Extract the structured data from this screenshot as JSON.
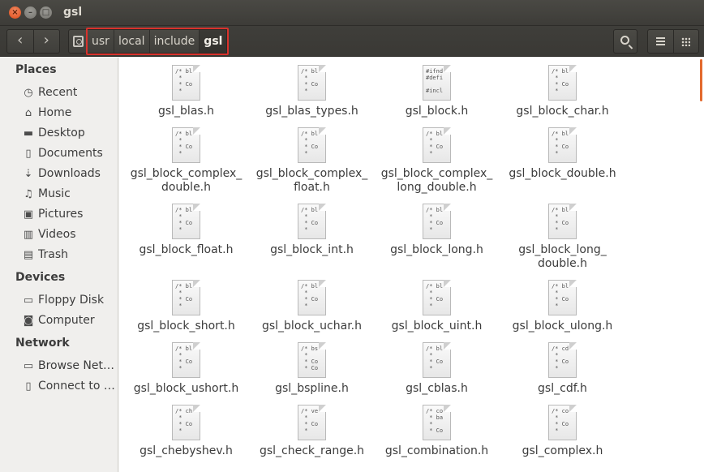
{
  "window": {
    "title": "gsl"
  },
  "toolbar": {
    "back_glyph": "‹",
    "forward_glyph": "›",
    "path": [
      "usr",
      "local",
      "include",
      "gsl"
    ],
    "search_icon": "search-icon",
    "view_icons": [
      "list-view-icon",
      "grid-view-icon"
    ]
  },
  "sidebar": {
    "places_header": "Places",
    "places": [
      {
        "label": "Recent",
        "icon": "clock-icon",
        "glyph": "◷"
      },
      {
        "label": "Home",
        "icon": "home-icon",
        "glyph": "⌂"
      },
      {
        "label": "Desktop",
        "icon": "folder-icon",
        "glyph": "▬"
      },
      {
        "label": "Documents",
        "icon": "document-icon",
        "glyph": "▯"
      },
      {
        "label": "Downloads",
        "icon": "download-icon",
        "glyph": "⇣"
      },
      {
        "label": "Music",
        "icon": "music-icon",
        "glyph": "♫"
      },
      {
        "label": "Pictures",
        "icon": "camera-icon",
        "glyph": "▣"
      },
      {
        "label": "Videos",
        "icon": "film-icon",
        "glyph": "▥"
      },
      {
        "label": "Trash",
        "icon": "trash-icon",
        "glyph": "▤"
      }
    ],
    "devices_header": "Devices",
    "devices": [
      {
        "label": "Floppy Disk",
        "icon": "floppy-icon",
        "glyph": "▭"
      },
      {
        "label": "Computer",
        "icon": "computer-icon",
        "glyph": "◙"
      }
    ],
    "network_header": "Network",
    "network": [
      {
        "label": "Browse Net…",
        "icon": "network-icon",
        "glyph": "▭"
      },
      {
        "label": "Connect to …",
        "icon": "server-icon",
        "glyph": "▯"
      }
    ]
  },
  "files": [
    {
      "name": "gsl_blas.h",
      "preview": "/* bl\n *\n * Co\n *"
    },
    {
      "name": "gsl_blas_types.h",
      "preview": "/* bl\n *\n * Co\n *"
    },
    {
      "name": "gsl_block.h",
      "preview": "#ifnd\n#defi\n\n#incl"
    },
    {
      "name": "gsl_block_char.h",
      "preview": "/* bl\n *\n * Co\n *"
    },
    {
      "name": "gsl_block_complex_\ndouble.h",
      "preview": "/* bl\n *\n * Co\n *"
    },
    {
      "name": "gsl_block_complex_\nfloat.h",
      "preview": "/* bl\n *\n * Co\n *"
    },
    {
      "name": "gsl_block_complex_\nlong_double.h",
      "preview": "/* bl\n *\n * Co\n *"
    },
    {
      "name": "gsl_block_double.h",
      "preview": "/* bl\n *\n * Co\n *"
    },
    {
      "name": "gsl_block_float.h",
      "preview": "/* bl\n *\n * Co\n *"
    },
    {
      "name": "gsl_block_int.h",
      "preview": "/* bl\n *\n * Co\n *"
    },
    {
      "name": "gsl_block_long.h",
      "preview": "/* bl\n *\n * Co\n *"
    },
    {
      "name": "gsl_block_long_\ndouble.h",
      "preview": "/* bl\n *\n * Co\n *"
    },
    {
      "name": "gsl_block_short.h",
      "preview": "/* bl\n *\n * Co\n *"
    },
    {
      "name": "gsl_block_uchar.h",
      "preview": "/* bl\n *\n * Co\n *"
    },
    {
      "name": "gsl_block_uint.h",
      "preview": "/* bl\n *\n * Co\n *"
    },
    {
      "name": "gsl_block_ulong.h",
      "preview": "/* bl\n *\n * Co\n *"
    },
    {
      "name": "gsl_block_ushort.h",
      "preview": "/* bl\n *\n * Co\n *"
    },
    {
      "name": "gsl_bspline.h",
      "preview": "/* bs\n *\n * Co\n * Co"
    },
    {
      "name": "gsl_cblas.h",
      "preview": "/* bl\n *\n * Co\n *"
    },
    {
      "name": "gsl_cdf.h",
      "preview": "/* cd\n *\n * Co\n *"
    },
    {
      "name": "gsl_chebyshev.h",
      "preview": "/* ch\n *\n * Co\n *"
    },
    {
      "name": "gsl_check_range.h",
      "preview": "/* ve\n *\n * Co\n *"
    },
    {
      "name": "gsl_combination.h",
      "preview": "/* co\n * ba\n *\n * Co"
    },
    {
      "name": "gsl_complex.h",
      "preview": "/* co\n *\n * Co\n *"
    }
  ]
}
